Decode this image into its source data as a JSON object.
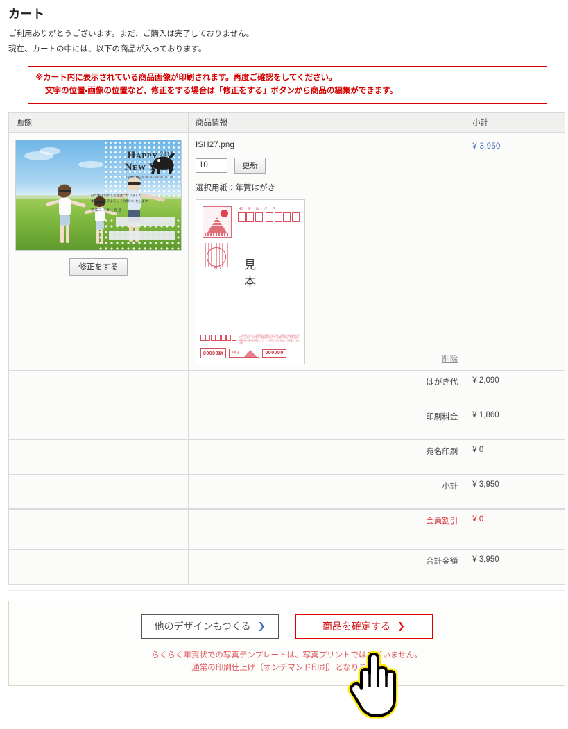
{
  "page": {
    "title": "カート",
    "intro_line1": "ご利用ありがとうございます。まだ、ご購入は完了しておりません。",
    "intro_line2": "現在、カートの中には、以下の商品が入っております。"
  },
  "notice": {
    "line1": "※カート内に表示されている商品画像が印刷されます。再度ご確認をしてください。",
    "line2": "文字の位置・画像の位置など、修正をする場合は「修正をする」ボタンから商品の編集ができます。",
    "border_color": "#d40000",
    "text_color": "#d40000"
  },
  "table": {
    "headers": {
      "image": "画像",
      "product_info": "商品情報",
      "subtotal": "小計"
    }
  },
  "item": {
    "filename": "ISH27.png",
    "quantity": "10",
    "update_button": "更新",
    "paper_label": "選択用紙：年賀はがき",
    "edit_button": "修正をする",
    "delete_link": "削除",
    "subtotal": "¥ 3,950",
    "subtotal_color": "#4a6fb5"
  },
  "photo_card": {
    "headline_line1": "Happy",
    "headline_year": "2018",
    "headline_line2": "New Year",
    "headline_sub": "I hope you spend a wonderful year",
    "greeting_line1": "旧年中は何かとお世話になりました",
    "greeting_line2": "本年もどうぞよろしくお願いいたします",
    "greeting_date": "平成三十年　元旦"
  },
  "nenga_sample": {
    "zip_title": "郵 便 は が き",
    "sample_char1": "見",
    "sample_char2": "本",
    "postmark_year": "2017",
    "lottery_group": "80000組",
    "lottery_number": "000000",
    "lottery_seal_text": "お年玉",
    "lottery_note": "この年賀はがきは一部寄附金を加算しております。寄附金のお払込みを完了しております。お年玉つき郵便はがき・お年玉つき郵便切手などに関する法律第1条の4第1項の規定により、くじ番号その他のお知らせを記載しております。"
  },
  "summary": [
    {
      "label": "はがき代",
      "value": "¥ 2,090",
      "type": "normal"
    },
    {
      "label": "印刷料金",
      "value": "¥ 1,860",
      "type": "normal"
    },
    {
      "label": "宛名印刷",
      "value": "¥ 0",
      "type": "normal"
    },
    {
      "label": "小計",
      "value": "¥ 3,950",
      "type": "normal"
    },
    {
      "label": "会員割引",
      "value": "¥ 0",
      "type": "discount"
    },
    {
      "label": "合計金額",
      "value": "¥ 3,950",
      "type": "normal"
    }
  ],
  "actions": {
    "other_design": "他のデザインもつくる",
    "confirm_product": "商品を確定する",
    "chevron": "❯",
    "other_design_border": "#555555",
    "confirm_border": "#e00000",
    "footnote_line1": "らくらく年賀状での写真テンプレートは、写真プリントではございません。",
    "footnote_line2": "通常の印刷仕上げ（オンデマンド印刷）となります。",
    "footnote_color": "#e0595f"
  }
}
